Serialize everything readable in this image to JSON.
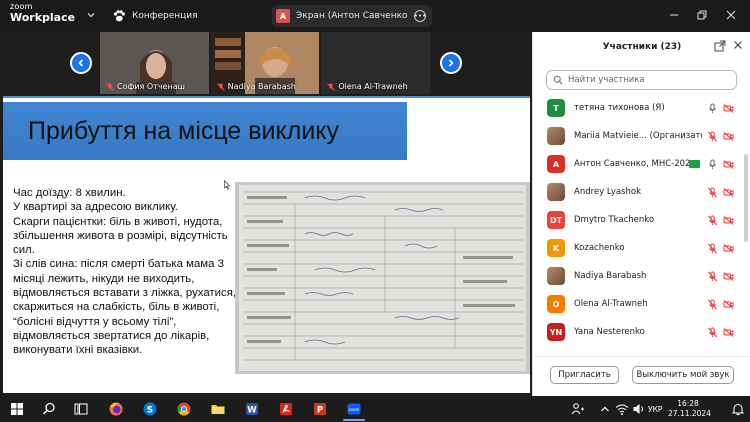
{
  "titlebar": {
    "logo_line1": "zoom",
    "logo_line2": "Workplace",
    "conference_label": "Конференция",
    "share_badge": "A",
    "share_label": "Экран (Антон Савченко, МНС-2"
  },
  "video_strip": {
    "tiles": [
      {
        "name": "София Отченаш"
      },
      {
        "name": "Nadiya Barabash"
      },
      {
        "name": "Olena Al-Trawneh"
      }
    ]
  },
  "slide": {
    "title": "Прибуття на місце виклику",
    "body": "Час доїзду: 8 хвилин.\nУ квартирі за адресою виклику.\nСкарги пацієнтки: біль в животі, нудота, збільшення живота в розмірі, відсутність сил.\nЗі слів сина: після смерті батька мама 3 місяці лежить, нікуди не виходить, відмовляється вставати з ліжка, рухатися, скаржиться на слабкість, біль в животі, “болісні відчуття у всьому тілі”, відмовляється звертатися до лікарів, виконувати їхні вказівки."
  },
  "participants": {
    "title": "Участники (23)",
    "search_placeholder": "Найти участника",
    "list": [
      {
        "initials": "T",
        "color": "#1e8e3e",
        "name": "тетяна тихонова (Я)",
        "mic": "on",
        "video": "off"
      },
      {
        "initials": "",
        "color": "photo",
        "name": "Mariia Matvieie... (Организатор)",
        "mic": "off",
        "video": "off"
      },
      {
        "initials": "A",
        "color": "#d93025",
        "name": "Антон Савченко, МНС-202...",
        "mic": "on",
        "video": "off",
        "sharing": true
      },
      {
        "initials": "",
        "color": "photo",
        "name": "Andrey Lyashok",
        "mic": "off",
        "video": "off"
      },
      {
        "initials": "DT",
        "color": "#e8453c",
        "name": "Dmytro Tkachenko",
        "mic": "off",
        "video": "off"
      },
      {
        "initials": "K",
        "color": "#f29900",
        "name": "Kozachenko",
        "mic": "off",
        "video": "off"
      },
      {
        "initials": "",
        "color": "photo",
        "name": "Nadiya Barabash",
        "mic": "off",
        "video": "off"
      },
      {
        "initials": "O",
        "color": "#f57c00",
        "name": "Olena Al-Trawneh",
        "mic": "off",
        "video": "off"
      },
      {
        "initials": "YN",
        "color": "#c5221f",
        "name": "Yana Nesterenko",
        "mic": "off",
        "video": "off"
      }
    ],
    "invite_label": "Пригласить",
    "mute_label": "Выключить мой звук"
  },
  "taskbar": {
    "language": "УКР",
    "time": "16:28",
    "date": "27.11.2024"
  },
  "colors": {
    "accent": "#1a73e8",
    "muted_red": "#e53935",
    "slide_band": "#3a7fcc"
  }
}
